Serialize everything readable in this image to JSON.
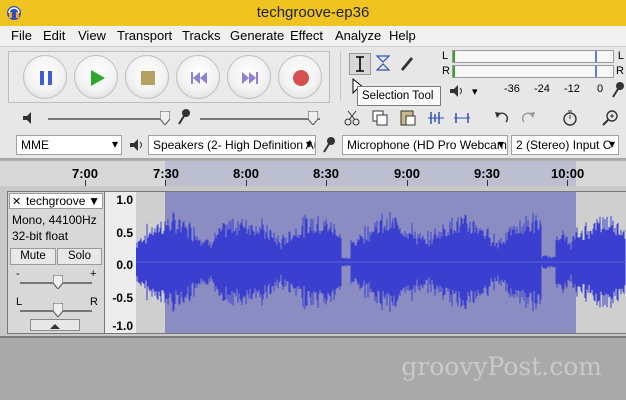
{
  "window": {
    "title": "techgroove-ep36"
  },
  "menu": [
    "File",
    "Edit",
    "View",
    "Transport",
    "Tracks",
    "Generate",
    "Effect",
    "Analyze",
    "Help"
  ],
  "transport": [
    "pause-icon",
    "play-icon",
    "stop-icon",
    "skip-start-icon",
    "skip-end-icon",
    "record-icon"
  ],
  "tooltip": "Selection Tool",
  "meter": {
    "left_label": "L",
    "right_label": "R",
    "scale": [
      "-36",
      "-24",
      "-12",
      "0"
    ]
  },
  "devices": {
    "host": "MME",
    "output": "Speakers (2- High Definition Au",
    "input": "Microphone (HD Pro Webcam C",
    "channels": "2 (Stereo) Input C"
  },
  "timeline": {
    "ticks": [
      "7:00",
      "7:30",
      "8:00",
      "8:30",
      "9:00",
      "9:30",
      "10:00"
    ]
  },
  "track": {
    "name": "techgroove",
    "info1": "Mono, 44100Hz",
    "info2": "32-bit float",
    "mute": "Mute",
    "solo": "Solo",
    "gain_minus": "-",
    "gain_plus": "+",
    "pan_left": "L",
    "pan_right": "R",
    "yaxis": [
      "1.0",
      "0.5",
      "0.0",
      "-0.5",
      "-1.0"
    ]
  },
  "watermark": "groovyPost.com",
  "colors": {
    "titlebar": "#f0c420",
    "waveform": "#3a3fcf",
    "selection": "#8b8dc2"
  }
}
